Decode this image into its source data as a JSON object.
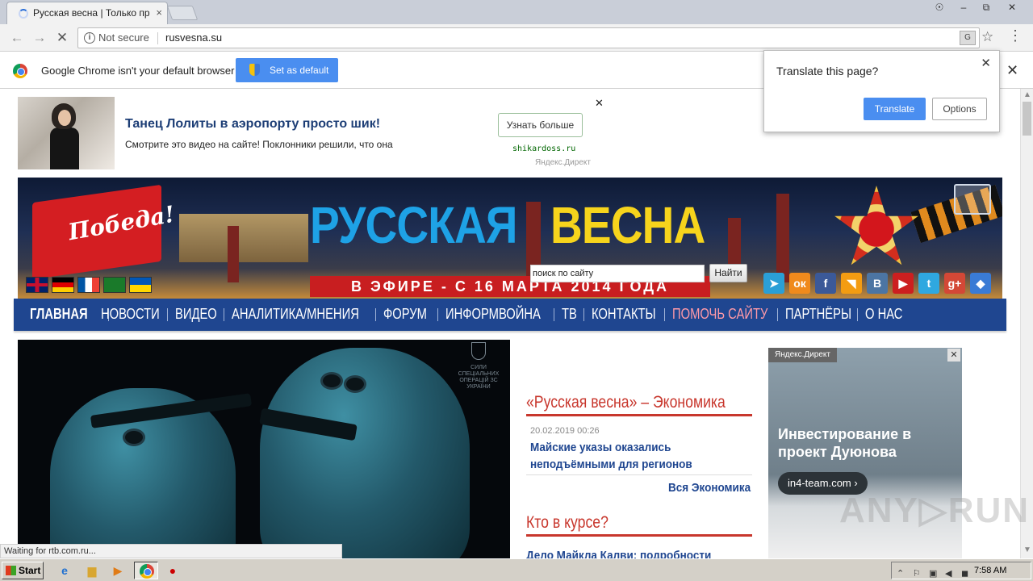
{
  "browser": {
    "tab_title": "Русская весна | Только пр",
    "tab_close": "×",
    "window_controls": [
      "☉",
      "–",
      "⧉",
      "✕"
    ],
    "not_secure": "Not secure",
    "info_icon": "i",
    "url": "rusvesna.su",
    "translate_icon": "G",
    "star_icon": "☆",
    "menu_icon": "⋮",
    "back_icon": "←",
    "forward_icon": "→",
    "reload_icon": "✕"
  },
  "infobar": {
    "text": "Google Chrome isn't your default browser",
    "button": "Set as default",
    "close": "✕"
  },
  "translate_popup": {
    "title": "Translate this page?",
    "translate_button": "Translate",
    "options_button": "Options",
    "close": "✕"
  },
  "top_ad": {
    "title": "Танец Лолиты в аэропорту просто шик!",
    "description": "Смотрите это видео на сайте! Поклонники решили, что она",
    "cta": "Узнать больше",
    "domain": "shikardoss.ru",
    "close": "✕",
    "network": "Яндекс.Директ"
  },
  "banner": {
    "flag_text": "Победа!",
    "title_part1": "РУССКАЯ",
    "title_part2": "ВЕСНА",
    "strip": "В ЭФИРЕ - С 16 МАРТА 2014 ГОДА",
    "social_icons": [
      "telegram-icon",
      "odnoklassniki-icon",
      "facebook-icon",
      "rss-icon",
      "vk-icon",
      "youtube-icon",
      "twitter-icon",
      "googleplus-icon",
      "tag-icon"
    ],
    "social_glyphs": [
      "➤",
      "ок",
      "f",
      "◥",
      "B",
      "▶",
      "t",
      "g+",
      "◆"
    ],
    "social_colors": [
      "#2a9fd6",
      "#f08a1c",
      "#3b5998",
      "#f39c12",
      "#4c75a3",
      "#cc1f1f",
      "#2fa8e0",
      "#d34836",
      "#3a7bd5"
    ]
  },
  "mainnav": {
    "items": [
      "ГЛАВНАЯ",
      "НОВОСТИ",
      "ВИДЕО",
      "АНАЛИТИКА/МНЕНИЯ",
      "ФОРУМ",
      "ИНФОРМВОЙНА",
      "ТВ",
      "КОНТАКТЫ",
      "ПОМОЧЬ САЙТУ",
      "ПАРТНЁРЫ",
      "О НАС"
    ]
  },
  "hero": {
    "emblem_text": "СИЛИ СПЕЦІАЛЬНИХ ОПЕРАЦІЙ ЗС УКРАЇНИ"
  },
  "search": {
    "value": "поиск по сайту",
    "button": "Найти"
  },
  "economics": {
    "title": "«Русская весна» – Экономика",
    "date": "20.02.2019 00:26",
    "headline": "Майские указы оказались неподъёмными для регионов",
    "all_link": "Вся Экономика"
  },
  "in_the_know": {
    "title": "Кто в курсе?",
    "first_headline": "Дело Майкла Калви: подробности"
  },
  "right_ad": {
    "network": "Яндекс.Директ",
    "close": "✕",
    "title": "Инвестирование в проект Дуюнова",
    "link": "in4-team.com ›"
  },
  "watermark": "ANY▷RUN",
  "status": "Waiting for rtb.com.ru...",
  "taskbar": {
    "start": "Start",
    "clock": "7:58 AM"
  }
}
